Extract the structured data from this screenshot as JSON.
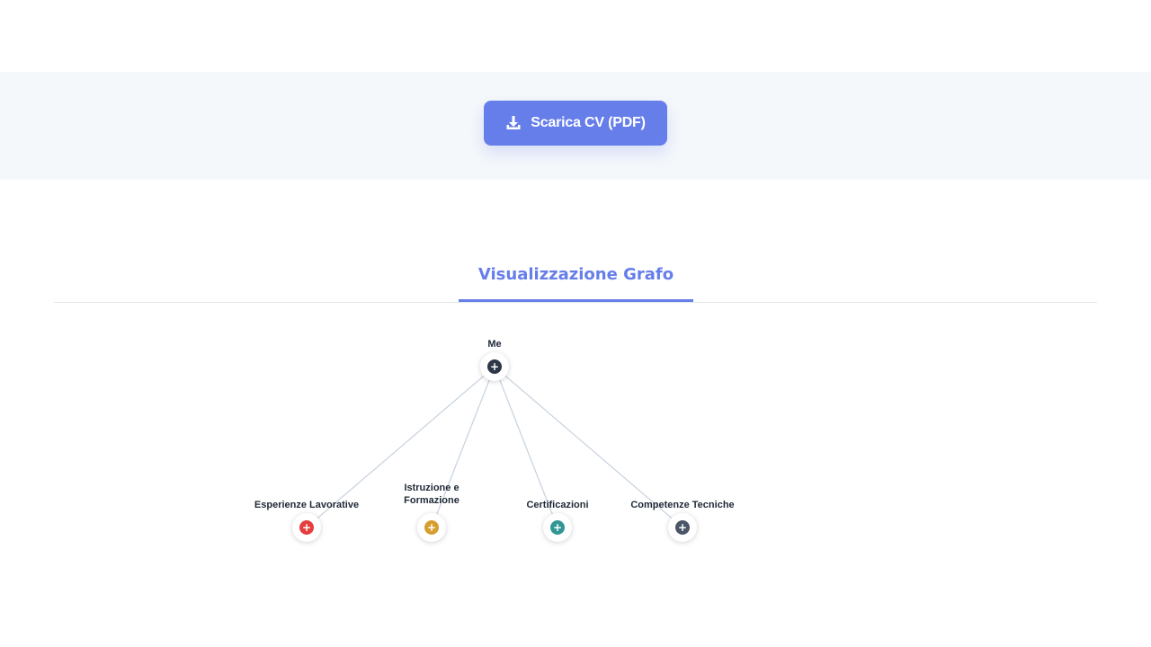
{
  "download": {
    "label": "Scarica CV (PDF)",
    "icon": "download-icon"
  },
  "tabs": {
    "active_label": "Visualizzazione Grafo"
  },
  "graph": {
    "root": {
      "label": "Me",
      "color": "#2d3748",
      "icon": "plus-icon"
    },
    "children": [
      {
        "label": "Esperienze Lavorative",
        "color": "#e53e3e",
        "icon": "plus-icon"
      },
      {
        "label_line1": "Istruzione e",
        "label_line2": "Formazione",
        "color": "#d69e2e",
        "icon": "plus-icon"
      },
      {
        "label": "Certificazioni",
        "color": "#319795",
        "icon": "plus-icon"
      },
      {
        "label": "Competenze Tecniche",
        "color": "#4a5568",
        "icon": "plus-icon"
      }
    ]
  },
  "colors": {
    "accent": "#667eea",
    "band_background": "#f5f8fb",
    "edge": "#cbd5e0"
  }
}
